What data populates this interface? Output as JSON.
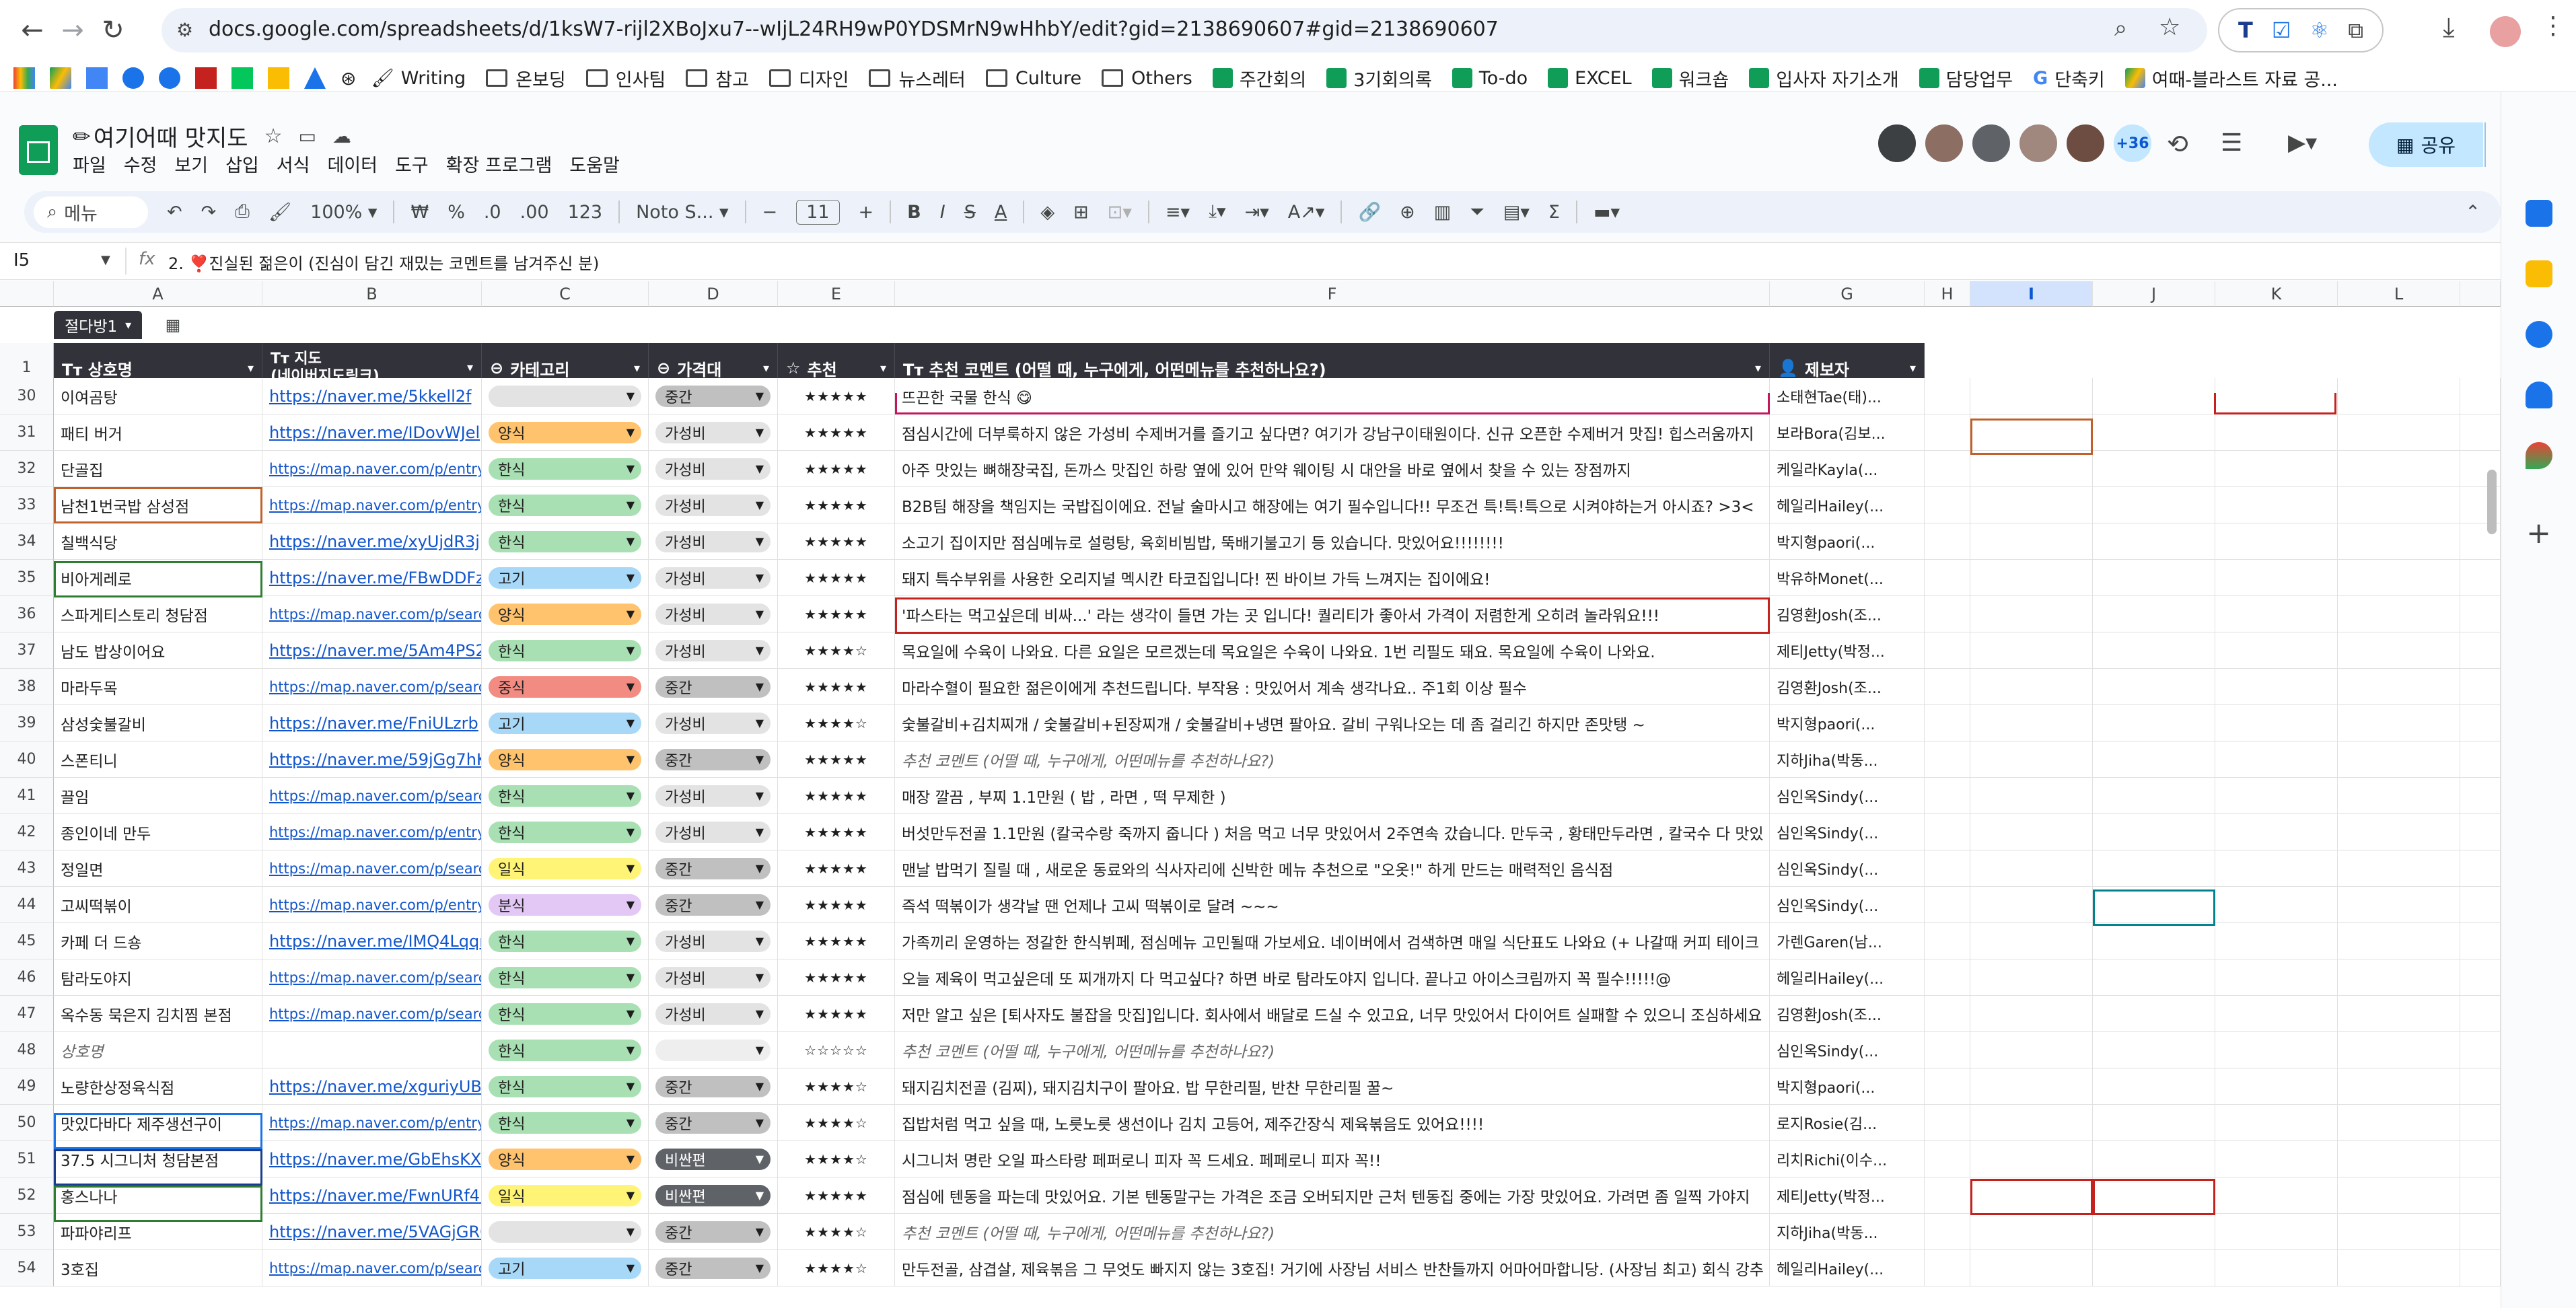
{
  "browser": {
    "url": "docs.google.com/spreadsheets/d/1ksW7-rijl2XBoJxu7--wIjL24RH9wP0YDSMrN9wHhbY/edit?gid=2138690607#gid=2138690607",
    "bookmarks": [
      "Writing",
      "온보딩",
      "인사팀",
      "참고",
      "디자인",
      "뉴스레터",
      "Culture",
      "Others",
      "주간회의",
      "3기회의록",
      "To-do",
      "EXCEL",
      "워크숍",
      "입사자 자기소개",
      "담당업무",
      "단축키",
      "여때-블라스트 자료 공..."
    ]
  },
  "doc": {
    "title": "여기어때 맛지도",
    "menus": [
      "파일",
      "수정",
      "보기",
      "삽입",
      "서식",
      "데이터",
      "도구",
      "확장 프로그램",
      "도움말"
    ],
    "share_label": "공유",
    "collaborator_count": "+36"
  },
  "toolbar": {
    "menu_search": "메뉴",
    "zoom": "100%",
    "currency": "₩",
    "percent": "%",
    "dec_down": ".0",
    "dec_up": ".00",
    "number_format": "123",
    "font": "Noto S...",
    "font_size": "11"
  },
  "formula": {
    "namebox": "I5",
    "fx": "fx",
    "content": "2. ❣️진실된 젊은이 (진심이 담긴 재밌는 코멘트를 남겨주신 분)"
  },
  "grid": {
    "columns": [
      "A",
      "B",
      "C",
      "D",
      "E",
      "F",
      "G",
      "H",
      "I",
      "J",
      "K",
      "L"
    ],
    "selected_column": "I",
    "filter_label": "절다방1",
    "header_row_number": "1",
    "headers": {
      "a": "Tт 상호명",
      "b": "Tт 지도\n(네이버지도링크)",
      "c": "카테고리",
      "d": "가격대",
      "e": "추천",
      "f": "Tт 추천 코멘트 (어떨 때, 누구에게, 어떤메뉴를 추천하나요?)",
      "g": "제보자"
    },
    "rows": [
      {
        "n": "30",
        "name": "이여곰탕",
        "link": "https://naver.me/5kkell2f",
        "cat": "",
        "price": "중간",
        "stars": "★★★★★",
        "comment": "뜨끈한 국물 한식 😋",
        "reporter": "소태현Tae(태)..."
      },
      {
        "n": "31",
        "name": "패티 버거",
        "link": "https://naver.me/IDovWJel",
        "cat": "양식",
        "price": "가성비",
        "stars": "★★★★★",
        "comment": "점심시간에 더부룩하지 않은 가성비 수제버거를 즐기고 싶다면? 여기가 강남구이태원이다. 신규 오픈한 수제버거 맛집! 힙스러움까지",
        "reporter": "보라Bora(김보..."
      },
      {
        "n": "32",
        "name": "단골집",
        "link": "https://map.naver.com/p/entry/pla",
        "cat": "한식",
        "price": "가성비",
        "stars": "★★★★★",
        "comment": "아주 맛있는 뼈해장국집, 돈까스 맛집인 하랑 옆에 있어 만약 웨이팅 시 대안을 바로 옆에서 찾을 수 있는 장점까지",
        "reporter": "케일라Kayla(..."
      },
      {
        "n": "33",
        "name": "남천1번국밥 삼성점",
        "link": "https://map.naver.com/p/entry/pla",
        "cat": "한식",
        "price": "가성비",
        "stars": "★★★★★",
        "comment": "B2B팀 해장을 책임지는 국밥집이에요. 전날 술마시고 해장에는 여기 필수입니다!! 무조건 특!특!특으로 시켜야하는거 아시죠? >3<",
        "reporter": "헤일리Hailey(..."
      },
      {
        "n": "34",
        "name": "칠백식당",
        "link": "https://naver.me/xyUjdR3j",
        "cat": "한식",
        "price": "가성비",
        "stars": "★★★★★",
        "comment": "소고기 집이지만 점심메뉴로 설렁탕, 육회비빔밥, 뚝배기불고기 등 있습니다. 맛있어요!!!!!!!!",
        "reporter": "박지형paori(..."
      },
      {
        "n": "35",
        "name": "비아게레로",
        "link": "https://naver.me/FBwDDFzR",
        "cat": "고기",
        "price": "가성비",
        "stars": "★★★★★",
        "comment": "돼지 특수부위를 사용한 오리지널 멕시칸 타코집입니다! 찐 바이브 가득 느껴지는 집이에요!",
        "reporter": "박유하Monet(..."
      },
      {
        "n": "36",
        "name": "스파게티스토리 청담점",
        "link": "https://map.naver.com/p/search/%",
        "cat": "양식",
        "price": "가성비",
        "stars": "★★★★★",
        "comment": "'파스타는 먹고싶은데 비싸...' 라는 생각이 들면 가는 곳 입니다! 퀄리티가 좋아서 가격이 저렴한게 오히려 놀라워요!!!",
        "reporter": "김영환Josh(조..."
      },
      {
        "n": "37",
        "name": "남도 밥상이어요",
        "link": "https://naver.me/5Am4PS2t",
        "cat": "한식",
        "price": "가성비",
        "stars": "★★★★☆",
        "comment": "목요일에 수육이 나와요. 다른 요일은 모르겠는데 목요일은 수육이 나와요. 1번 리필도 돼요. 목요일에 수육이 나와요.",
        "reporter": "제티Jetty(박정..."
      },
      {
        "n": "38",
        "name": "마라두목",
        "link": "https://map.naver.com/p/search/%",
        "cat": "중식",
        "price": "중간",
        "stars": "★★★★★",
        "comment": "마라수혈이 필요한 젊은이에게 추천드립니다. 부작용 : 맛있어서 계속 생각나요.. 주1회 이상 필수",
        "reporter": "김영환Josh(조..."
      },
      {
        "n": "39",
        "name": "삼성숯불갈비",
        "link": "https://naver.me/FniULzrb",
        "cat": "고기",
        "price": "가성비",
        "stars": "★★★★☆",
        "comment": "숯불갈비+김치찌개 / 숯불갈비+된장찌개 / 숯불갈비+냉면 팔아요. 갈비 구워나오는 데 좀 걸리긴 하지만 존맛탱 ~",
        "reporter": "박지형paori(..."
      },
      {
        "n": "40",
        "name": "스폰티니",
        "link": "https://naver.me/59jGg7hK",
        "cat": "양식",
        "price": "중간",
        "stars": "★★★★★",
        "comment": "추천 코멘트 (어떨 때, 누구에게, 어떤메뉴를 추천하나요?)",
        "reporter": "지하Jiha(박동..."
      },
      {
        "n": "41",
        "name": "끌임",
        "link": "https://map.naver.com/p/search/%",
        "cat": "한식",
        "price": "가성비",
        "stars": "★★★★★",
        "comment": "매장 깔끔 , 부찌 1.1만원 ( 밥 , 라면 , 떡 무제한 )",
        "reporter": "심인옥Sindy(..."
      },
      {
        "n": "42",
        "name": "종인이네 만두",
        "link": "https://map.naver.com/p/entry/pla",
        "cat": "한식",
        "price": "가성비",
        "stars": "★★★★★",
        "comment": "버섯만두전골 1.1만원 (칼국수랑 죽까지 줍니다 ) 처음 먹고 너무 맛있어서 2주연속 갔습니다. 만두국 , 황태만두라면 , 칼국수 다 맛있",
        "reporter": "심인옥Sindy(..."
      },
      {
        "n": "43",
        "name": "정일면",
        "link": "https://map.naver.com/p/search/%",
        "cat": "일식",
        "price": "중간",
        "stars": "★★★★★",
        "comment": "맨날 밥먹기 질릴 때 , 새로운 동료와의 식사자리에 신박한 메뉴 추천으로 \"오옷!\" 하게 만드는 매력적인 음식점",
        "reporter": "심인옥Sindy(..."
      },
      {
        "n": "44",
        "name": "고씨떡볶이",
        "link": "https://map.naver.com/p/entry/pla",
        "cat": "분식",
        "price": "중간",
        "stars": "★★★★★",
        "comment": "즉석 떡볶이가 생각날 땐 언제나 고씨 떡볶이로 달려 ~~~",
        "reporter": "심인옥Sindy(..."
      },
      {
        "n": "45",
        "name": "카페 더 드숑",
        "link": "https://naver.me/IMQ4Lqqr",
        "cat": "한식",
        "price": "가성비",
        "stars": "★★★★★",
        "comment": "가족끼리 운영하는 정갈한 한식뷔페, 점심메뉴 고민될때 가보세요. 네이버에서 검색하면 매일 식단표도 나와요 (+ 나갈때 커피 테이크",
        "reporter": "가렌Garen(남..."
      },
      {
        "n": "46",
        "name": "탐라도야지",
        "link": "https://map.naver.com/p/search/%",
        "cat": "한식",
        "price": "가성비",
        "stars": "★★★★★",
        "comment": "오늘 제육이 먹고싶은데 또 찌개까지 다 먹고싶다? 하면 바로 탐라도야지 입니다. 끝나고 아이스크림까지 꼭 필수!!!!!@",
        "reporter": "헤일리Hailey(..."
      },
      {
        "n": "47",
        "name": "옥수동 묵은지 김치찜 본점",
        "link": "https://map.naver.com/p/search/%",
        "cat": "한식",
        "price": "가성비",
        "stars": "★★★★★",
        "comment": "저만 알고 싶은 [퇴사자도 불잡을 맛집]입니다. 회사에서 배달로 드실 수 있고요, 너무 맛있어서 다이어트 실패할 수 있으니 조심하세요",
        "reporter": "김영환Josh(조..."
      },
      {
        "n": "48",
        "name": "상호명",
        "link": "",
        "cat": "한식",
        "price": "",
        "stars": "☆☆☆☆☆",
        "comment": "추천 코멘트 (어떨 때, 누구에게, 어떤메뉴를 추천하나요?)",
        "reporter": "심인옥Sindy(..."
      },
      {
        "n": "49",
        "name": "노량한상정육식점",
        "link": "https://naver.me/xguriyUB",
        "cat": "한식",
        "price": "중간",
        "stars": "★★★★☆",
        "comment": "돼지김치전골 (김찌), 돼지김치구이 팔아요. 밥 무한리필, 반찬 무한리필 꿀~",
        "reporter": "박지형paori(..."
      },
      {
        "n": "50",
        "name": "맛있다바다 제주생선구이",
        "link": "https://map.naver.com/p/entry/pla",
        "cat": "한식",
        "price": "중간",
        "stars": "★★★★☆",
        "comment": "집밥처럼 먹고 싶을 때, 노릇노릇 생선이나 김치 고등어, 제주간장식 제육볶음도 있어요!!!!",
        "reporter": "로지Rosie(김..."
      },
      {
        "n": "51",
        "name": "37.5 시그니처 청담본점",
        "link": "https://naver.me/GbEhsKXC",
        "cat": "양식",
        "price": "비싼편",
        "stars": "★★★★☆",
        "comment": "시그니처 명란 오일 파스타랑 페퍼로니 피자 꼭 드세요. 페페로니 피자 꼭!!",
        "reporter": "리치Richi(이수..."
      },
      {
        "n": "52",
        "name": "홍스나나",
        "link": "https://naver.me/FwnURf4m",
        "cat": "일식",
        "price": "비싼편",
        "stars": "★★★★★",
        "comment": "점심에 텐동을 파는데 맛있어요. 기본 텐동말구는 가격은 조금 오버되지만 근처 텐동집 중에는 가장 맛있어요. 가려면 좀 일찍 가야지",
        "reporter": "제티Jetty(박정..."
      },
      {
        "n": "53",
        "name": "파파야리프",
        "link": "https://naver.me/5VAGjGRQ",
        "cat": "",
        "price": "중간",
        "stars": "★★★★☆",
        "comment": "추천 코멘트 (어떨 때, 누구에게, 어떤메뉴를 추천하나요?)",
        "reporter": "지하Jiha(박동..."
      },
      {
        "n": "54",
        "name": "3호집",
        "link": "https://map.naver.com/p/search/3",
        "cat": "고기",
        "price": "중간",
        "stars": "★★★★☆",
        "comment": "만두전골, 삼겹살, 제육볶음 그 무엇도 빠지지 않는 3호집! 거기에 사장님 서비스 반찬들까지 어마어마합니당. (사장님 최고) 회식 강추",
        "reporter": "헤일리Hailey(..."
      }
    ]
  },
  "colors": {
    "header_bg": "#32323a",
    "chip_한식": "#a8e0b4",
    "chip_양식": "#ffc36e",
    "chip_고기": "#a7d8f7",
    "chip_중식": "#f28b82",
    "chip_일식": "#fff475",
    "chip_분식": "#e3c8f5",
    "chip_가성비": "#e3e3e3",
    "chip_중간": "#c0c0c0",
    "chip_비싼편": "#5f6368"
  }
}
